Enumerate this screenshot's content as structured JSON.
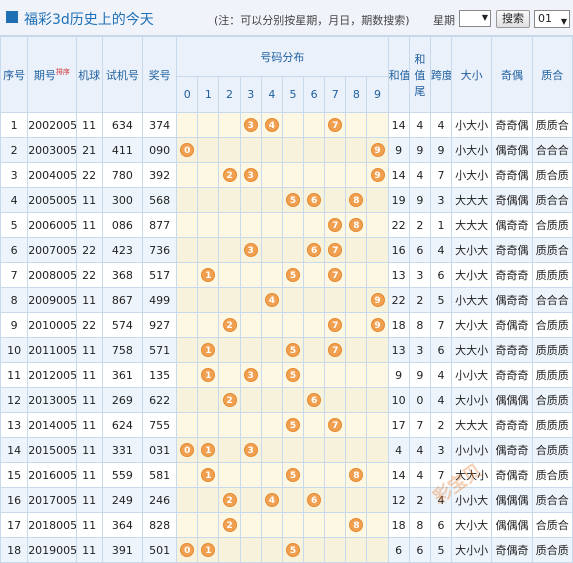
{
  "header": {
    "title": "福彩3d历史上的今天",
    "note": "(注：可以分别按星期，月日，期数搜索)",
    "week_label": "星期",
    "week_value": "",
    "search_label": "搜索",
    "day_value": "01"
  },
  "table": {
    "col_headers": {
      "seq": "序号",
      "issue": "期号",
      "sort": "排序",
      "machine": "机球",
      "test": "试机号",
      "prize": "奖号",
      "dist": "号码分布",
      "sum": "和值",
      "sum_tail": "和值尾",
      "span": "跨度",
      "size": "大小",
      "parity": "奇偶",
      "prime": "质合"
    },
    "digits": [
      "0",
      "1",
      "2",
      "3",
      "4",
      "5",
      "6",
      "7",
      "8",
      "9"
    ],
    "rows": [
      {
        "seq": "1",
        "issue": "2002005",
        "machine": "11",
        "test": "634",
        "prize": "374",
        "balls": [
          3,
          4,
          7
        ],
        "sum": "14",
        "tail": "4",
        "span": "4",
        "size": "小大小",
        "parity": "奇奇偶",
        "prime": "质质合"
      },
      {
        "seq": "2",
        "issue": "2003005",
        "machine": "21",
        "test": "411",
        "prize": "090",
        "balls": [
          0,
          9
        ],
        "sum": "9",
        "tail": "9",
        "span": "9",
        "size": "小大小",
        "parity": "偶奇偶",
        "prime": "合合合"
      },
      {
        "seq": "3",
        "issue": "2004005",
        "machine": "22",
        "test": "780",
        "prize": "392",
        "balls": [
          2,
          3,
          9
        ],
        "sum": "14",
        "tail": "4",
        "span": "7",
        "size": "小大小",
        "parity": "奇奇偶",
        "prime": "质合质"
      },
      {
        "seq": "4",
        "issue": "2005005",
        "machine": "11",
        "test": "300",
        "prize": "568",
        "balls": [
          5,
          6,
          8
        ],
        "sum": "19",
        "tail": "9",
        "span": "3",
        "size": "大大大",
        "parity": "奇偶偶",
        "prime": "质合合"
      },
      {
        "seq": "5",
        "issue": "2006005",
        "machine": "11",
        "test": "086",
        "prize": "877",
        "balls": [
          7,
          8
        ],
        "sum": "22",
        "tail": "2",
        "span": "1",
        "size": "大大大",
        "parity": "偶奇奇",
        "prime": "合质质"
      },
      {
        "seq": "6",
        "issue": "2007005",
        "machine": "22",
        "test": "423",
        "prize": "736",
        "balls": [
          3,
          6,
          7
        ],
        "sum": "16",
        "tail": "6",
        "span": "4",
        "size": "大小大",
        "parity": "奇奇偶",
        "prime": "质质合"
      },
      {
        "seq": "7",
        "issue": "2008005",
        "machine": "22",
        "test": "368",
        "prize": "517",
        "balls": [
          1,
          5,
          7
        ],
        "sum": "13",
        "tail": "3",
        "span": "6",
        "size": "大小大",
        "parity": "奇奇奇",
        "prime": "质质质"
      },
      {
        "seq": "8",
        "issue": "2009005",
        "machine": "11",
        "test": "867",
        "prize": "499",
        "balls": [
          4,
          9
        ],
        "sum": "22",
        "tail": "2",
        "span": "5",
        "size": "小大大",
        "parity": "偶奇奇",
        "prime": "合合合"
      },
      {
        "seq": "9",
        "issue": "2010005",
        "machine": "22",
        "test": "574",
        "prize": "927",
        "balls": [
          2,
          7,
          9
        ],
        "sum": "18",
        "tail": "8",
        "span": "7",
        "size": "大小大",
        "parity": "奇偶奇",
        "prime": "合质质"
      },
      {
        "seq": "10",
        "issue": "2011005",
        "machine": "11",
        "test": "758",
        "prize": "571",
        "balls": [
          1,
          5,
          7
        ],
        "sum": "13",
        "tail": "3",
        "span": "6",
        "size": "大大小",
        "parity": "奇奇奇",
        "prime": "质质质"
      },
      {
        "seq": "11",
        "issue": "2012005",
        "machine": "11",
        "test": "361",
        "prize": "135",
        "balls": [
          1,
          3,
          5
        ],
        "sum": "9",
        "tail": "9",
        "span": "4",
        "size": "小小大",
        "parity": "奇奇奇",
        "prime": "质质质"
      },
      {
        "seq": "12",
        "issue": "2013005",
        "machine": "11",
        "test": "269",
        "prize": "622",
        "balls": [
          2,
          6
        ],
        "sum": "10",
        "tail": "0",
        "span": "4",
        "size": "大小小",
        "parity": "偶偶偶",
        "prime": "合质质"
      },
      {
        "seq": "13",
        "issue": "2014005",
        "machine": "11",
        "test": "624",
        "prize": "755",
        "balls": [
          5,
          7
        ],
        "sum": "17",
        "tail": "7",
        "span": "2",
        "size": "大大大",
        "parity": "奇奇奇",
        "prime": "质质质"
      },
      {
        "seq": "14",
        "issue": "2015005",
        "machine": "11",
        "test": "331",
        "prize": "031",
        "balls": [
          0,
          1,
          3
        ],
        "sum": "4",
        "tail": "4",
        "span": "3",
        "size": "小小小",
        "parity": "偶奇奇",
        "prime": "合质质"
      },
      {
        "seq": "15",
        "issue": "2016005",
        "machine": "11",
        "test": "559",
        "prize": "581",
        "balls": [
          1,
          5,
          8
        ],
        "sum": "14",
        "tail": "4",
        "span": "7",
        "size": "大大小",
        "parity": "奇偶奇",
        "prime": "质合质"
      },
      {
        "seq": "16",
        "issue": "2017005",
        "machine": "11",
        "test": "249",
        "prize": "246",
        "balls": [
          2,
          4,
          6
        ],
        "sum": "12",
        "tail": "2",
        "span": "4",
        "size": "小小大",
        "parity": "偶偶偶",
        "prime": "质合合"
      },
      {
        "seq": "17",
        "issue": "2018005",
        "machine": "11",
        "test": "364",
        "prize": "828",
        "balls": [
          2,
          8
        ],
        "sum": "18",
        "tail": "8",
        "span": "6",
        "size": "大小大",
        "parity": "偶偶偶",
        "prime": "合质合"
      },
      {
        "seq": "18",
        "issue": "2019005",
        "machine": "11",
        "test": "391",
        "prize": "501",
        "balls": [
          0,
          1,
          5
        ],
        "sum": "6",
        "tail": "6",
        "span": "5",
        "size": "大小小",
        "parity": "奇偶奇",
        "prime": "质合质"
      }
    ]
  },
  "watermark": "彩宝贝 www.78500.cn"
}
